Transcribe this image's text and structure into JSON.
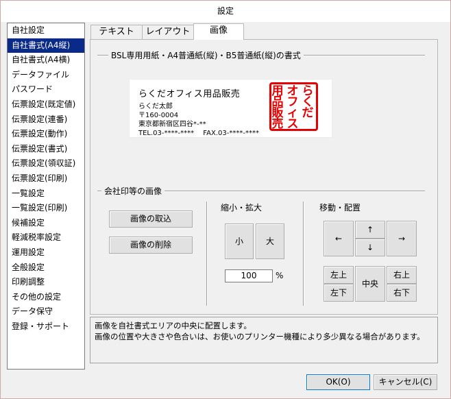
{
  "window": {
    "title": "設定"
  },
  "sidebar": {
    "selected_index": 1,
    "items": [
      {
        "label": "自社設定"
      },
      {
        "label": "自社書式(A4縦)"
      },
      {
        "label": "自社書式(A4横)"
      },
      {
        "label": "データファイル"
      },
      {
        "label": "パスワード"
      },
      {
        "label": "伝票設定(既定値)"
      },
      {
        "label": "伝票設定(連番)"
      },
      {
        "label": "伝票設定(動作)"
      },
      {
        "label": "伝票設定(書式)"
      },
      {
        "label": "伝票設定(領収証)"
      },
      {
        "label": "伝票設定(印刷)"
      },
      {
        "label": "一覧設定"
      },
      {
        "label": "一覧設定(印刷)"
      },
      {
        "label": "候補設定"
      },
      {
        "label": "軽減税率設定"
      },
      {
        "label": "運用設定"
      },
      {
        "label": "全般設定"
      },
      {
        "label": "印刷調整"
      },
      {
        "label": "その他の設定"
      },
      {
        "label": "データ保守"
      },
      {
        "label": "登録・サポート"
      }
    ]
  },
  "tabs": [
    {
      "label": "テキスト"
    },
    {
      "label": "レイアウト"
    },
    {
      "label": "画像"
    }
  ],
  "active_tab": 2,
  "preview_section": {
    "title": "BSL専用用紙・A4普通紙(縦)・B5普通紙(縦)の書式",
    "company_name": "らくだオフィス用品販売",
    "person": "らくだ太郎",
    "postal": "〒160-0004",
    "address": "東京都新宿区四谷*-**",
    "phone_fax": "TEL.03-****-****　 FAX.03-****-****",
    "stamp_columns": [
      "らくだ",
      "オフィス",
      "用品販売"
    ],
    "stamp_color": "#e60000"
  },
  "image_section": {
    "title": "会社印等の画像",
    "import_button": "画像の取込",
    "delete_button": "画像の削除"
  },
  "scale_section": {
    "title": "縮小・拡大",
    "small_button": "小",
    "large_button": "大",
    "value": "100",
    "unit": "%"
  },
  "move_section": {
    "title": "移動・配置",
    "left": "←",
    "up": "↑",
    "down": "↓",
    "right": "→",
    "top_left": "左上",
    "bottom_left": "左下",
    "center": "中央",
    "top_right": "右上",
    "bottom_right": "右下"
  },
  "message": {
    "line1": "画像を自社書式エリアの中央に配置します。",
    "line2": "画像の位置や大きさや色合いは、お使いのプリンター機種により多少異なる場合があります。"
  },
  "footer": {
    "ok": "OK(O)",
    "cancel": "キャンセル(C)"
  },
  "colors": {
    "selection": "#0a2a8a",
    "stamp_red": "#e60000"
  }
}
